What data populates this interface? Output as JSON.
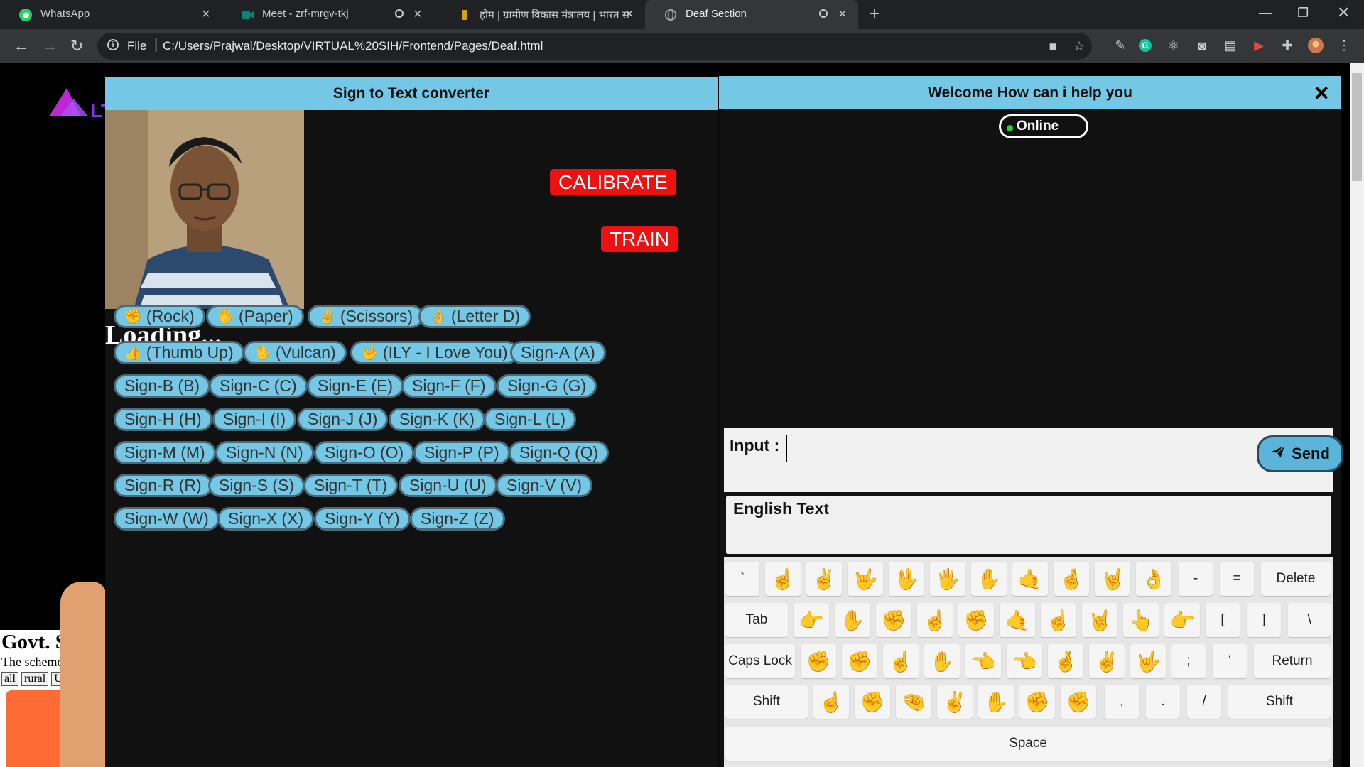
{
  "browser": {
    "tabs": [
      {
        "title": "WhatsApp",
        "icon": "whatsapp-icon"
      },
      {
        "title": "Meet - zrf-mrgv-tkj",
        "icon": "meet-icon"
      },
      {
        "title": "होम | ग्रामीण विकास मंत्रालय | भारत स",
        "icon": "emblem-icon"
      },
      {
        "title": "Deaf Section",
        "icon": "globe-icon"
      }
    ],
    "url_scheme": "File",
    "url": "C:/Users/Prajwal/Desktop/VIRTUAL%20SIH/Frontend/Pages/Deaf.html"
  },
  "background_page": {
    "title": "Govt. Scl",
    "subtitle": "The schemes",
    "filters": [
      "all",
      "rural",
      "Urba"
    ]
  },
  "sign_panel": {
    "title": "Sign to Text converter",
    "calibrate_label": "CALIBRATE",
    "train_label": "TRAIN",
    "status": "Loading...",
    "gestures": [
      {
        "emoji": "✊",
        "label": "(Rock)"
      },
      {
        "emoji": "🖐",
        "label": "(Paper)"
      },
      {
        "emoji": "✌",
        "label": "(Scissors)"
      },
      {
        "emoji": "👌",
        "label": "(Letter D)"
      },
      {
        "emoji": "👍",
        "label": "(Thumb Up)"
      },
      {
        "emoji": "🖖",
        "label": "(Vulcan)"
      },
      {
        "emoji": "🤟",
        "label": "(ILY - I Love You)"
      },
      {
        "emoji": "",
        "label": "Sign-A (A)"
      },
      {
        "emoji": "",
        "label": "Sign-B (B)"
      },
      {
        "emoji": "",
        "label": "Sign-C (C)"
      },
      {
        "emoji": "",
        "label": "Sign-E (E)"
      },
      {
        "emoji": "",
        "label": "Sign-F (F)"
      },
      {
        "emoji": "",
        "label": "Sign-G (G)"
      },
      {
        "emoji": "",
        "label": "Sign-H (H)"
      },
      {
        "emoji": "",
        "label": "Sign-I (I)"
      },
      {
        "emoji": "",
        "label": "Sign-J (J)"
      },
      {
        "emoji": "",
        "label": "Sign-K (K)"
      },
      {
        "emoji": "",
        "label": "Sign-L (L)"
      },
      {
        "emoji": "",
        "label": "Sign-M (M)"
      },
      {
        "emoji": "",
        "label": "Sign-N (N)"
      },
      {
        "emoji": "",
        "label": "Sign-O (O)"
      },
      {
        "emoji": "",
        "label": "Sign-P (P)"
      },
      {
        "emoji": "",
        "label": "Sign-Q (Q)"
      },
      {
        "emoji": "",
        "label": "Sign-R (R)"
      },
      {
        "emoji": "",
        "label": "Sign-S (S)"
      },
      {
        "emoji": "",
        "label": "Sign-T (T)"
      },
      {
        "emoji": "",
        "label": "Sign-U (U)"
      },
      {
        "emoji": "",
        "label": "Sign-V (V)"
      },
      {
        "emoji": "",
        "label": "Sign-W (W)"
      },
      {
        "emoji": "",
        "label": "Sign-X (X)"
      },
      {
        "emoji": "",
        "label": "Sign-Y (Y)"
      },
      {
        "emoji": "",
        "label": "Sign-Z (Z)"
      }
    ]
  },
  "chat_panel": {
    "title": "Welcome How can i help you",
    "status": "Online",
    "input_label": "Input :",
    "send_label": "Send",
    "english_label": "English Text"
  },
  "keyboard": {
    "row1_start": "`",
    "row1_hands": [
      "☝",
      "✌",
      "🤟",
      "🖖",
      "🖐",
      "✋",
      "🤙",
      "🤞",
      "🤘",
      "👌"
    ],
    "row1_end": [
      "-",
      "=",
      "Delete"
    ],
    "tab_label": "Tab",
    "row2_hands": [
      "👉",
      "✋",
      "✊",
      "☝",
      "✊",
      "🤙",
      "☝",
      "🤘",
      "👆",
      "👉"
    ],
    "row2_end": [
      "[",
      "]",
      "\\"
    ],
    "caps_label": "Caps Lock",
    "row3_hands": [
      "✊",
      "✊",
      "☝",
      "✋",
      "👈",
      "👈",
      "🤞",
      "✌",
      "🤟"
    ],
    "row3_end": [
      ";",
      "'",
      "Return"
    ],
    "shift_label": "Shift",
    "row4_hands": [
      "☝",
      "✊",
      "🤏",
      "✌",
      "✋",
      "✊",
      "✊"
    ],
    "row4_end": [
      ",",
      ".",
      "/"
    ],
    "space_label": "Space"
  },
  "colors": {
    "accent": "#74c8e6",
    "danger": "#ee1111",
    "online": "#2ecc40"
  }
}
